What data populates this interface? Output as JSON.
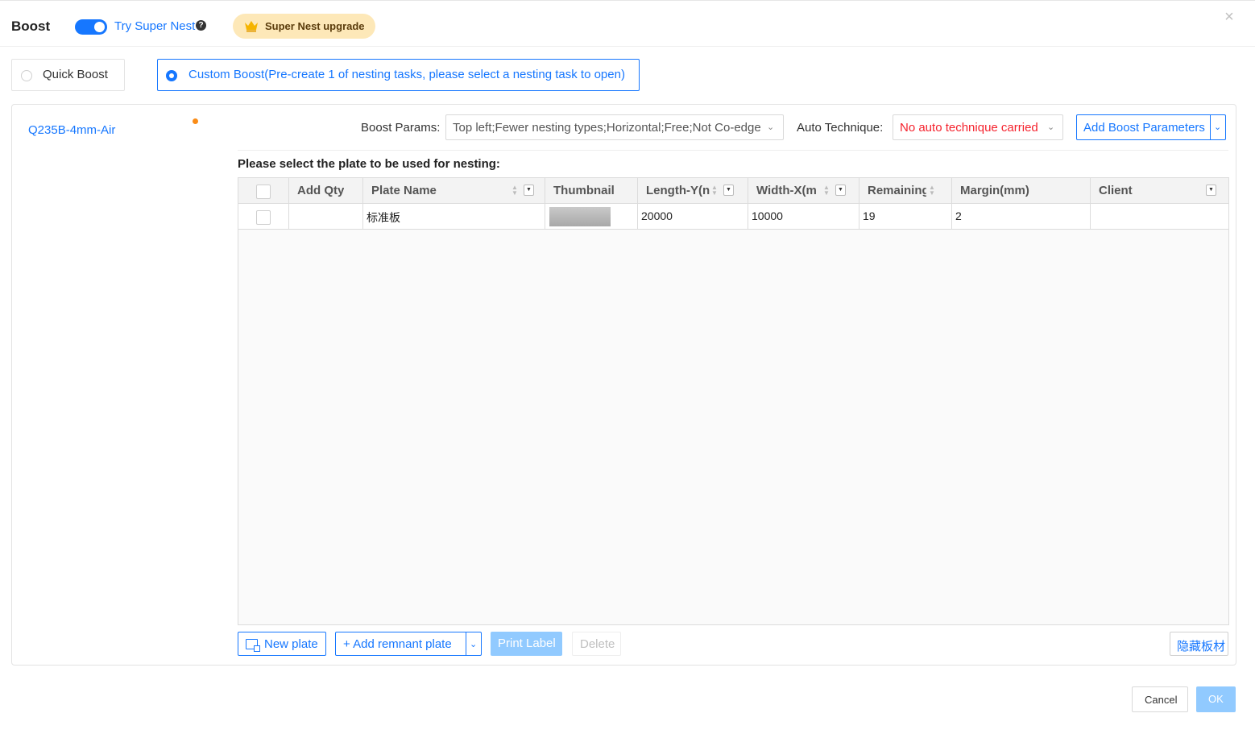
{
  "header": {
    "title": "Boost",
    "toggle_on": true,
    "try_label": "Try Super Nest",
    "help_glyph": "?",
    "upgrade_label": "Super Nest upgrade",
    "close_glyph": "×"
  },
  "modes": {
    "quick_label": "Quick Boost",
    "custom_label": "Custom Boost(Pre-create 1 of nesting tasks, please select a nesting task to open)",
    "selected": "custom"
  },
  "task": {
    "name": "Q235B-4mm-Air"
  },
  "params": {
    "boost_label": "Boost Params:",
    "boost_value": "Top left;Fewer nesting types;Horizontal;Free;Not Co-edge",
    "tech_label": "Auto Technique:",
    "tech_value": "No auto technique carried",
    "add_label": "Add Boost Parameters"
  },
  "plates": {
    "hint": "Please select the plate to be used for nesting:",
    "columns": {
      "add_qty": "Add Qty",
      "plate_name": "Plate Name",
      "thumbnail": "Thumbnail",
      "length": "Length-Y(n",
      "width": "Width-X(m",
      "remaining": "Remaining",
      "margin": "Margin(mm)",
      "client": "Client"
    },
    "rows": [
      {
        "add_qty": "",
        "plate_name": "标准板",
        "length": "20000",
        "width": "10000",
        "remaining": "19",
        "margin": "2",
        "client": ""
      }
    ]
  },
  "actions": {
    "new_plate": "New plate",
    "add_remnant": "+ Add remnant plate",
    "print_label": "Print Label",
    "delete": "Delete",
    "hide_plates": "隐藏板材"
  },
  "footer": {
    "cancel": "Cancel",
    "ok": "OK"
  },
  "colors": {
    "primary": "#1677ff",
    "primary_disabled": "#91caff",
    "error": "#f5222d",
    "warning_dot": "#fa8c16",
    "upgrade_bg": "#fde8b8"
  }
}
